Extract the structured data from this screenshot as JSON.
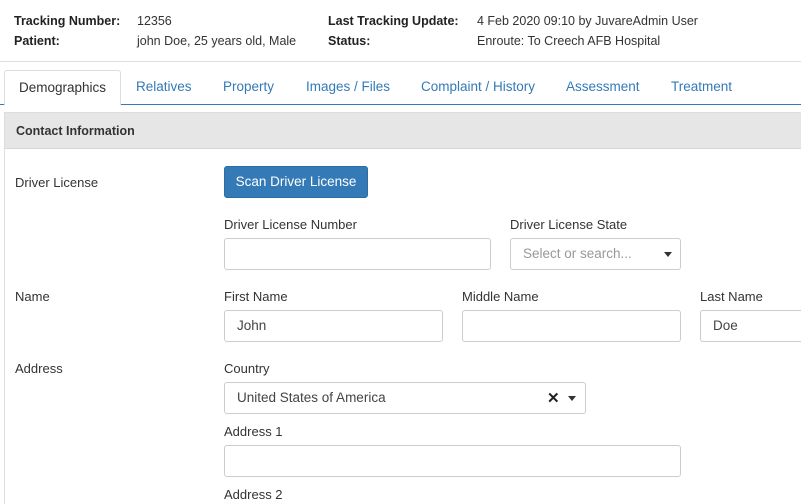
{
  "header": {
    "tracking_number_label": "Tracking Number:",
    "tracking_number_value": "12356",
    "patient_label": "Patient:",
    "patient_value": "john Doe, 25 years old, Male",
    "last_update_label": "Last Tracking Update:",
    "last_update_value": "4 Feb 2020 09:10 by JuvareAdmin User",
    "status_label": "Status:",
    "status_value": "Enroute: To Creech AFB Hospital"
  },
  "tabs": [
    {
      "label": "Demographics",
      "active": true
    },
    {
      "label": "Relatives"
    },
    {
      "label": "Property"
    },
    {
      "label": "Images / Files"
    },
    {
      "label": "Complaint / History"
    },
    {
      "label": "Assessment"
    },
    {
      "label": "Treatment"
    }
  ],
  "panel": {
    "title": "Contact Information"
  },
  "driver_license": {
    "row_label": "Driver License",
    "scan_button": "Scan Driver License",
    "number_label": "Driver License Number",
    "number_value": "",
    "state_label": "Driver License State",
    "state_placeholder": "Select or search..."
  },
  "name": {
    "row_label": "Name",
    "first_label": "First Name",
    "first_value": "John",
    "middle_label": "Middle Name",
    "middle_value": "",
    "last_label": "Last Name",
    "last_value": "Doe"
  },
  "address": {
    "row_label": "Address",
    "country_label": "Country",
    "country_value": "United States of America",
    "address1_label": "Address 1",
    "address1_value": "",
    "address2_label": "Address 2"
  },
  "colors": {
    "accent": "#337ab7",
    "panel_header_bg": "#e6e6e6"
  }
}
